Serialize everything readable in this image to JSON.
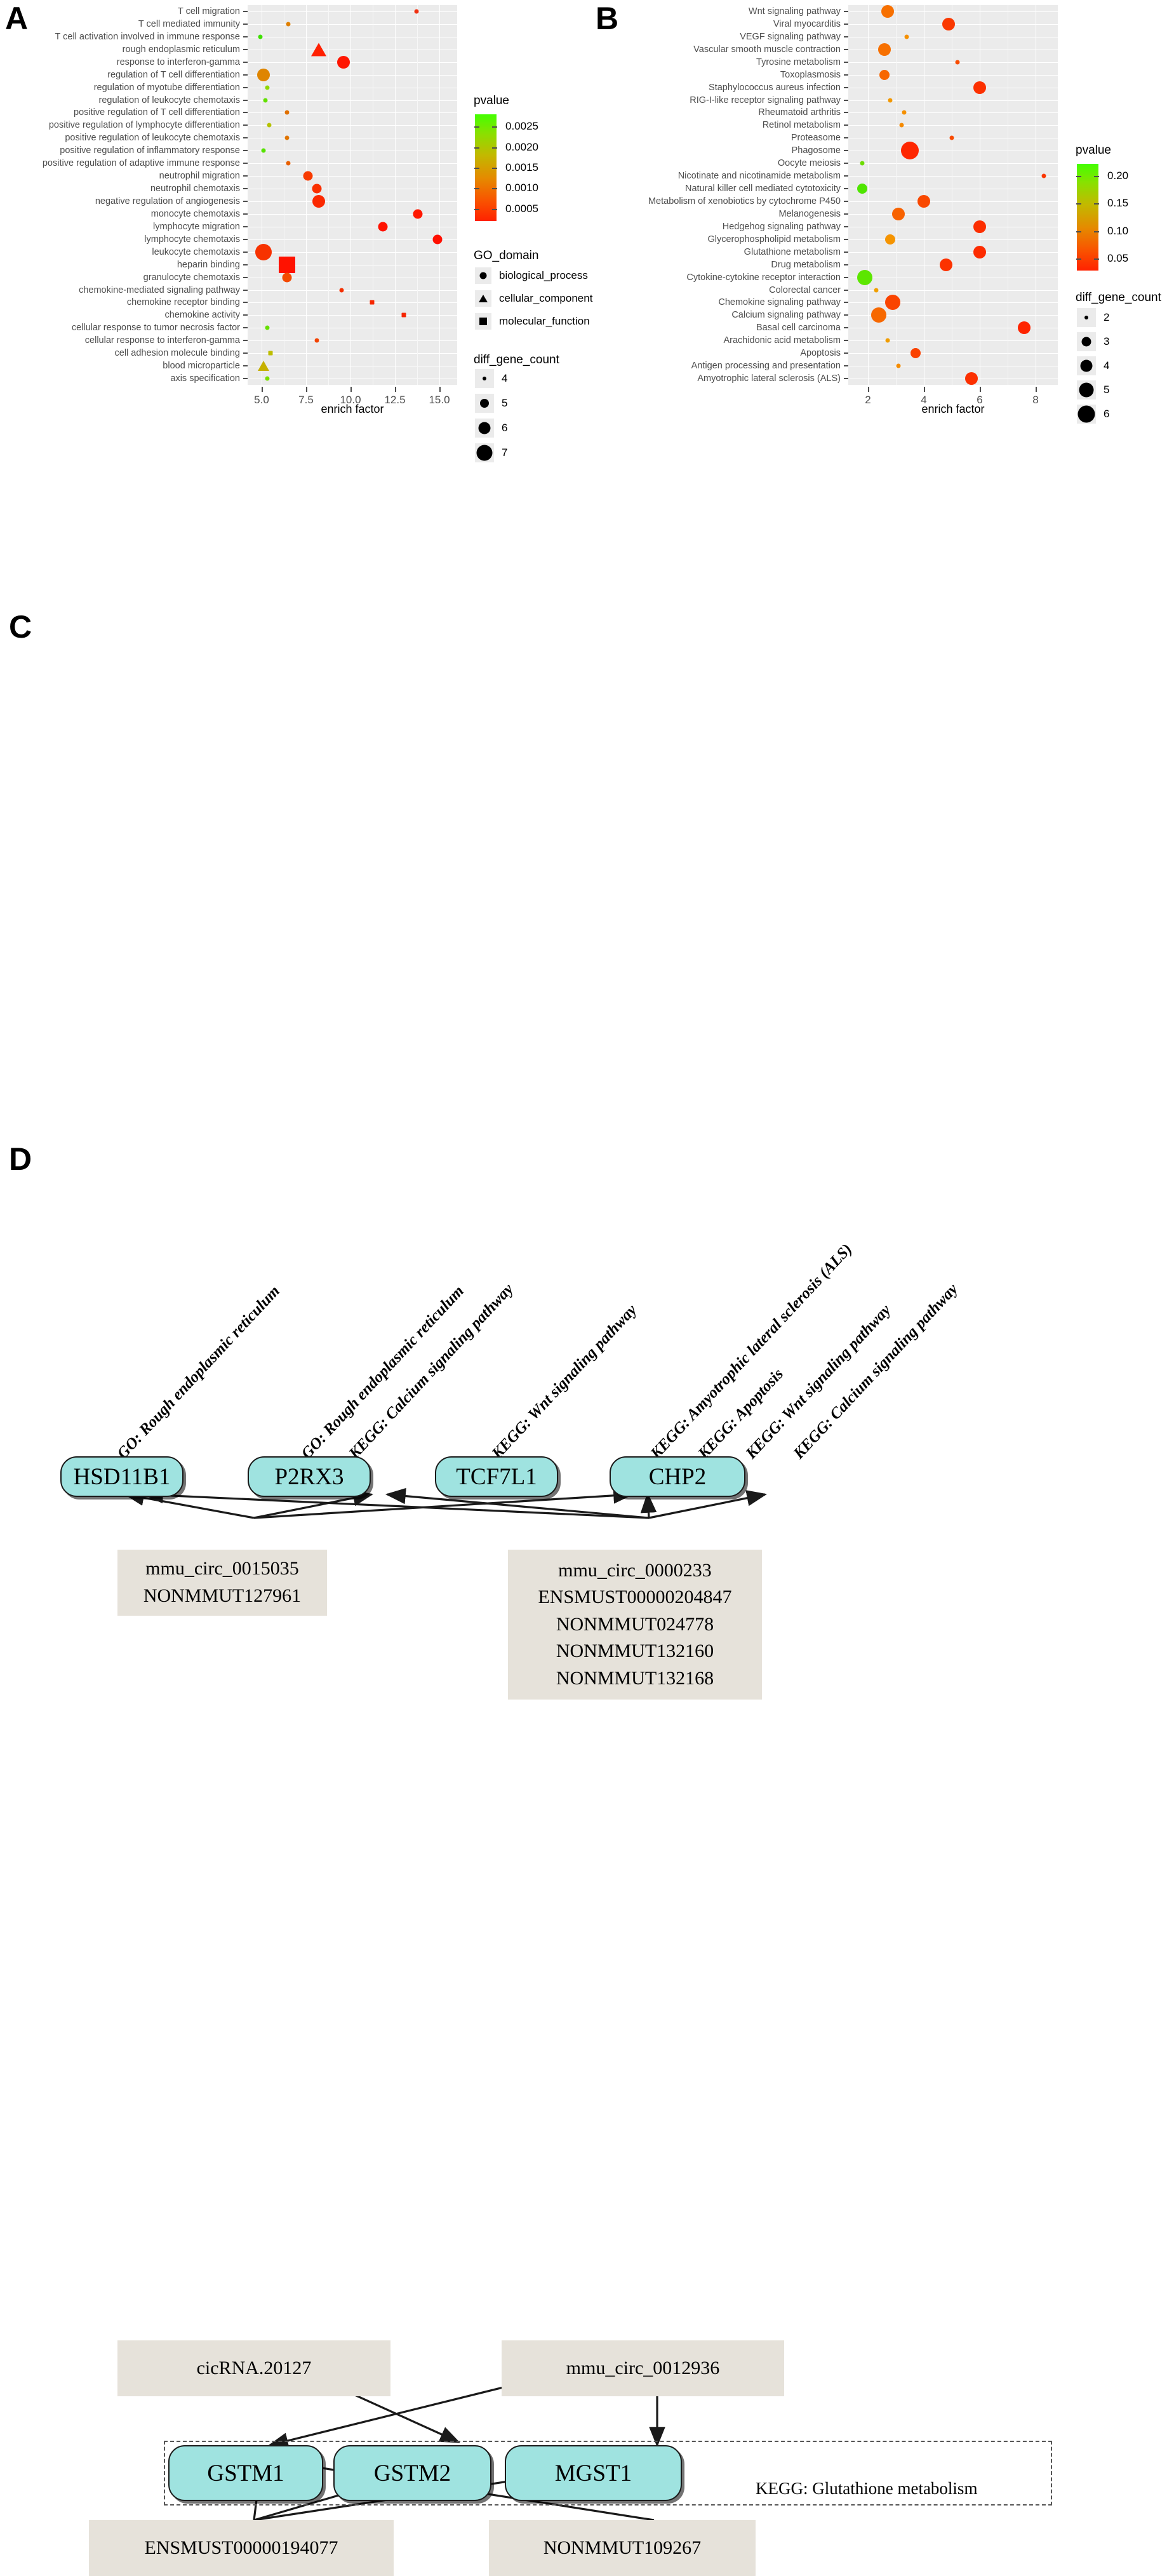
{
  "figure": {
    "panels": [
      "A",
      "B",
      "C",
      "D"
    ]
  },
  "panelA": {
    "letter": "A",
    "chart_data": {
      "type": "scatter",
      "title": "",
      "xlabel": "enrich factor",
      "ylabel": "",
      "xlim": [
        4.2,
        16.0
      ],
      "xticks": [
        "5.0",
        "7.5",
        "10.0",
        "12.5",
        "15.0"
      ],
      "xtickvalues": [
        5.0,
        7.5,
        10.0,
        12.5,
        15.0
      ],
      "grid": true,
      "legend_position": "right",
      "categories": [
        "T cell migration",
        "T cell mediated immunity",
        "T cell activation involved in immune response",
        "rough endoplasmic reticulum",
        "response to interferon-gamma",
        "regulation of T cell differentiation",
        "regulation of myotube differentiation",
        "regulation of leukocyte chemotaxis",
        "positive regulation of T cell differentiation",
        "positive regulation of lymphocyte differentiation",
        "positive regulation of leukocyte chemotaxis",
        "positive regulation of inflammatory response",
        "positive regulation of adaptive immune response",
        "neutrophil migration",
        "neutrophil chemotaxis",
        "negative regulation of angiogenesis",
        "monocyte chemotaxis",
        "lymphocyte migration",
        "lymphocyte chemotaxis",
        "leukocyte chemotaxis",
        "heparin binding",
        "granulocyte chemotaxis",
        "chemokine-mediated signaling pathway",
        "chemokine receptor binding",
        "chemokine activity",
        "cellular response to tumor necrosis factor",
        "cellular response to interferon-gamma",
        "cell adhesion molecule binding",
        "blood microparticle",
        "axis specification"
      ],
      "points": [
        {
          "category": "T cell migration",
          "enrich_factor": 13.7,
          "pvalue": 0.0004,
          "diff_gene_count": 4,
          "go_domain": "biological_process",
          "color": "#f03010"
        },
        {
          "category": "T cell mediated immunity",
          "enrich_factor": 6.5,
          "pvalue": 0.0013,
          "diff_gene_count": 4,
          "go_domain": "biological_process",
          "color": "#e08000"
        },
        {
          "category": "T cell activation involved in immune response",
          "enrich_factor": 4.9,
          "pvalue": 0.0026,
          "diff_gene_count": 4,
          "go_domain": "biological_process",
          "color": "#3fe000"
        },
        {
          "category": "rough endoplasmic reticulum",
          "enrich_factor": 8.2,
          "pvalue": 0.0002,
          "diff_gene_count": 6,
          "go_domain": "cellular_component",
          "color": "#ff2000"
        },
        {
          "category": "response to interferon-gamma",
          "enrich_factor": 9.6,
          "pvalue": 0.0002,
          "diff_gene_count": 6,
          "go_domain": "biological_process",
          "color": "#ff1500"
        },
        {
          "category": "regulation of T cell differentiation",
          "enrich_factor": 5.1,
          "pvalue": 0.0011,
          "diff_gene_count": 6,
          "go_domain": "biological_process",
          "color": "#df8500"
        },
        {
          "category": "regulation of myotube differentiation",
          "enrich_factor": 5.3,
          "pvalue": 0.0023,
          "diff_gene_count": 4,
          "go_domain": "biological_process",
          "color": "#90d800"
        },
        {
          "category": "regulation of leukocyte chemotaxis",
          "enrich_factor": 5.2,
          "pvalue": 0.0025,
          "diff_gene_count": 4,
          "go_domain": "biological_process",
          "color": "#62e000"
        },
        {
          "category": "positive regulation of T cell differentiation",
          "enrich_factor": 6.4,
          "pvalue": 0.0009,
          "diff_gene_count": 4,
          "go_domain": "biological_process",
          "color": "#e07000"
        },
        {
          "category": "positive regulation of lymphocyte differentiation",
          "enrich_factor": 5.4,
          "pvalue": 0.0019,
          "diff_gene_count": 4,
          "go_domain": "biological_process",
          "color": "#b5c200"
        },
        {
          "category": "positive regulation of leukocyte chemotaxis",
          "enrich_factor": 6.4,
          "pvalue": 0.0009,
          "diff_gene_count": 4,
          "go_domain": "biological_process",
          "color": "#e07500"
        },
        {
          "category": "positive regulation of inflammatory response",
          "enrich_factor": 5.1,
          "pvalue": 0.0026,
          "diff_gene_count": 4,
          "go_domain": "biological_process",
          "color": "#55e200"
        },
        {
          "category": "positive regulation of adaptive immune response",
          "enrich_factor": 6.5,
          "pvalue": 0.0007,
          "diff_gene_count": 4,
          "go_domain": "biological_process",
          "color": "#e86000"
        },
        {
          "category": "neutrophil migration",
          "enrich_factor": 7.6,
          "pvalue": 0.0003,
          "diff_gene_count": 5,
          "go_domain": "biological_process",
          "color": "#f83a00"
        },
        {
          "category": "neutrophil chemotaxis",
          "enrich_factor": 8.1,
          "pvalue": 0.0003,
          "diff_gene_count": 5,
          "go_domain": "biological_process",
          "color": "#fa3000"
        },
        {
          "category": "negative regulation of angiogenesis",
          "enrich_factor": 8.2,
          "pvalue": 0.0002,
          "diff_gene_count": 6,
          "go_domain": "biological_process",
          "color": "#fb2800"
        },
        {
          "category": "monocyte chemotaxis",
          "enrich_factor": 13.8,
          "pvalue": 0.0002,
          "diff_gene_count": 5,
          "go_domain": "biological_process",
          "color": "#ff1800"
        },
        {
          "category": "lymphocyte migration",
          "enrich_factor": 11.8,
          "pvalue": 0.0002,
          "diff_gene_count": 5,
          "go_domain": "biological_process",
          "color": "#ff1200"
        },
        {
          "category": "lymphocyte chemotaxis",
          "enrich_factor": 14.9,
          "pvalue": 0.0002,
          "diff_gene_count": 5,
          "go_domain": "biological_process",
          "color": "#ff1000"
        },
        {
          "category": "leukocyte chemotaxis",
          "enrich_factor": 5.1,
          "pvalue": 0.0003,
          "diff_gene_count": 7,
          "go_domain": "biological_process",
          "color": "#f73200"
        },
        {
          "category": "heparin binding",
          "enrich_factor": 6.4,
          "pvalue": 0.0002,
          "diff_gene_count": 7,
          "go_domain": "molecular_function",
          "color": "#ff1200"
        },
        {
          "category": "granulocyte chemotaxis",
          "enrich_factor": 6.4,
          "pvalue": 0.0005,
          "diff_gene_count": 5,
          "go_domain": "biological_process",
          "color": "#f44a00"
        },
        {
          "category": "chemokine-mediated signaling pathway",
          "enrich_factor": 9.5,
          "pvalue": 0.0004,
          "diff_gene_count": 4,
          "go_domain": "biological_process",
          "color": "#f43000"
        },
        {
          "category": "chemokine receptor binding",
          "enrich_factor": 11.2,
          "pvalue": 0.0003,
          "diff_gene_count": 4,
          "go_domain": "molecular_function",
          "color": "#f62800"
        },
        {
          "category": "chemokine activity",
          "enrich_factor": 13.0,
          "pvalue": 0.0003,
          "diff_gene_count": 4,
          "go_domain": "molecular_function",
          "color": "#f62600"
        },
        {
          "category": "cellular response to tumor necrosis factor",
          "enrich_factor": 5.3,
          "pvalue": 0.0025,
          "diff_gene_count": 4,
          "go_domain": "biological_process",
          "color": "#66e000"
        },
        {
          "category": "cellular response to interferon-gamma",
          "enrich_factor": 8.1,
          "pvalue": 0.0005,
          "diff_gene_count": 4,
          "go_domain": "biological_process",
          "color": "#f34300"
        },
        {
          "category": "cell adhesion molecule binding",
          "enrich_factor": 5.5,
          "pvalue": 0.0018,
          "diff_gene_count": 4,
          "go_domain": "molecular_function",
          "color": "#bdbd00"
        },
        {
          "category": "blood microparticle",
          "enrich_factor": 5.1,
          "pvalue": 0.0017,
          "diff_gene_count": 5,
          "go_domain": "cellular_component",
          "color": "#c6b000"
        },
        {
          "category": "axis specification",
          "enrich_factor": 5.3,
          "pvalue": 0.0024,
          "diff_gene_count": 4,
          "go_domain": "biological_process",
          "color": "#7ade00"
        }
      ]
    },
    "legends": {
      "pvalue": {
        "title": "pvalue",
        "ticks": [
          "0.0025",
          "0.0020",
          "0.0015",
          "0.0010",
          "0.0005"
        ],
        "tickvalues": [
          0.0025,
          0.002,
          0.0015,
          0.001,
          0.0005
        ],
        "gradient_high_color": "#44ff00",
        "gradient_low_color": "#ff2200"
      },
      "go_domain": {
        "title": "GO_domain",
        "items": [
          {
            "label": "biological_process",
            "shape": "circle"
          },
          {
            "label": "cellular_component",
            "shape": "triangle"
          },
          {
            "label": "molecular_function",
            "shape": "square"
          }
        ]
      },
      "diff_gene_count": {
        "title": "diff_gene_count",
        "items": [
          {
            "label": "4",
            "size": 6
          },
          {
            "label": "5",
            "size": 14
          },
          {
            "label": "6",
            "size": 19
          },
          {
            "label": "7",
            "size": 25
          }
        ]
      }
    }
  },
  "panelB": {
    "letter": "B",
    "chart_data": {
      "type": "scatter",
      "title": "",
      "xlabel": "enrich factor",
      "ylabel": "",
      "xlim": [
        1.3,
        8.8
      ],
      "xticks": [
        "2",
        "4",
        "6",
        "8"
      ],
      "xtickvalues": [
        2,
        4,
        6,
        8
      ],
      "grid": true,
      "legend_position": "right",
      "categories": [
        "Wnt signaling pathway",
        "Viral myocarditis",
        "VEGF signaling pathway",
        "Vascular smooth muscle contraction",
        "Tyrosine metabolism",
        "Toxoplasmosis",
        "Staphylococcus aureus infection",
        "RIG-I-like receptor signaling pathway",
        "Rheumatoid arthritis",
        "Retinol metabolism",
        "Proteasome",
        "Phagosome",
        "Oocyte meiosis",
        "Nicotinate and nicotinamide metabolism",
        "Natural killer cell mediated cytotoxicity",
        "Metabolism of xenobiotics by cytochrome P450",
        "Melanogenesis",
        "Hedgehog signaling pathway",
        "Glycerophospholipid metabolism",
        "Glutathione metabolism",
        "Drug metabolism",
        "Cytokine-cytokine receptor interaction",
        "Colorectal cancer",
        "Chemokine signaling pathway",
        "Calcium signaling pathway",
        "Basal cell carcinoma",
        "Arachidonic acid metabolism",
        "Apoptosis",
        "Antigen processing and presentation",
        "Amyotrophic lateral sclerosis (ALS)"
      ],
      "points": [
        {
          "category": "Wnt signaling pathway",
          "enrich_factor": 2.7,
          "pvalue": 0.055,
          "diff_gene_count": 4,
          "color": "#f77000"
        },
        {
          "category": "Viral myocarditis",
          "enrich_factor": 4.9,
          "pvalue": 0.035,
          "diff_gene_count": 4,
          "color": "#fa3800"
        },
        {
          "category": "VEGF signaling pathway",
          "enrich_factor": 3.4,
          "pvalue": 0.075,
          "diff_gene_count": 2,
          "color": "#f59000"
        },
        {
          "category": "Vascular smooth muscle contraction",
          "enrich_factor": 2.6,
          "pvalue": 0.055,
          "diff_gene_count": 4,
          "color": "#f77000"
        },
        {
          "category": "Tyrosine metabolism",
          "enrich_factor": 5.2,
          "pvalue": 0.045,
          "diff_gene_count": 2,
          "color": "#f84c00"
        },
        {
          "category": "Toxoplasmosis",
          "enrich_factor": 2.6,
          "pvalue": 0.05,
          "diff_gene_count": 3,
          "color": "#f76600"
        },
        {
          "category": "Staphylococcus aureus infection",
          "enrich_factor": 6.0,
          "pvalue": 0.03,
          "diff_gene_count": 4,
          "color": "#fc3000"
        },
        {
          "category": "RIG-I-like receptor signaling pathway",
          "enrich_factor": 2.8,
          "pvalue": 0.085,
          "diff_gene_count": 2,
          "color": "#f29800"
        },
        {
          "category": "Rheumatoid arthritis",
          "enrich_factor": 3.3,
          "pvalue": 0.075,
          "diff_gene_count": 2,
          "color": "#f59000"
        },
        {
          "category": "Retinol metabolism",
          "enrich_factor": 3.2,
          "pvalue": 0.07,
          "diff_gene_count": 2,
          "color": "#f58a00"
        },
        {
          "category": "Proteasome",
          "enrich_factor": 5.0,
          "pvalue": 0.045,
          "diff_gene_count": 2,
          "color": "#f84c00"
        },
        {
          "category": "Phagosome",
          "enrich_factor": 3.5,
          "pvalue": 0.02,
          "diff_gene_count": 6,
          "color": "#fe2600"
        },
        {
          "category": "Oocyte meiosis",
          "enrich_factor": 1.8,
          "pvalue": 0.19,
          "diff_gene_count": 2,
          "color": "#6ddc00"
        },
        {
          "category": "Nicotinate and nicotinamide metabolism",
          "enrich_factor": 8.3,
          "pvalue": 0.035,
          "diff_gene_count": 2,
          "color": "#fa3800"
        },
        {
          "category": "Natural killer cell mediated cytotoxicity",
          "enrich_factor": 1.8,
          "pvalue": 0.2,
          "diff_gene_count": 3,
          "color": "#4fe500"
        },
        {
          "category": "Metabolism of xenobiotics by cytochrome P450",
          "enrich_factor": 4.0,
          "pvalue": 0.045,
          "diff_gene_count": 4,
          "color": "#f94800"
        },
        {
          "category": "Melanogenesis",
          "enrich_factor": 3.1,
          "pvalue": 0.048,
          "diff_gene_count": 4,
          "color": "#f86200"
        },
        {
          "category": "Hedgehog signaling pathway",
          "enrich_factor": 6.0,
          "pvalue": 0.028,
          "diff_gene_count": 4,
          "color": "#fc2e00"
        },
        {
          "category": "Glycerophospholipid metabolism",
          "enrich_factor": 2.8,
          "pvalue": 0.08,
          "diff_gene_count": 3,
          "color": "#f59400"
        },
        {
          "category": "Glutathione metabolism",
          "enrich_factor": 6.0,
          "pvalue": 0.026,
          "diff_gene_count": 4,
          "color": "#fd2c00"
        },
        {
          "category": "Drug metabolism",
          "enrich_factor": 4.8,
          "pvalue": 0.03,
          "diff_gene_count": 4,
          "color": "#fc3200"
        },
        {
          "category": "Cytokine-cytokine receptor interaction",
          "enrich_factor": 1.9,
          "pvalue": 0.23,
          "diff_gene_count": 5,
          "color": "#5ce600"
        },
        {
          "category": "Colorectal cancer",
          "enrich_factor": 2.3,
          "pvalue": 0.095,
          "diff_gene_count": 2,
          "color": "#f0a000"
        },
        {
          "category": "Chemokine signaling pathway",
          "enrich_factor": 2.9,
          "pvalue": 0.04,
          "diff_gene_count": 5,
          "color": "#fa4400"
        },
        {
          "category": "Calcium signaling pathway",
          "enrich_factor": 2.4,
          "pvalue": 0.048,
          "diff_gene_count": 5,
          "color": "#f76800"
        },
        {
          "category": "Basal cell carcinoma",
          "enrich_factor": 7.6,
          "pvalue": 0.022,
          "diff_gene_count": 4,
          "color": "#fe2400"
        },
        {
          "category": "Arachidonic acid metabolism",
          "enrich_factor": 2.7,
          "pvalue": 0.09,
          "diff_gene_count": 2,
          "color": "#f09c00"
        },
        {
          "category": "Apoptosis",
          "enrich_factor": 3.7,
          "pvalue": 0.04,
          "diff_gene_count": 3,
          "color": "#fa4200"
        },
        {
          "category": "Antigen processing and presentation",
          "enrich_factor": 3.1,
          "pvalue": 0.075,
          "diff_gene_count": 2,
          "color": "#f58c00"
        },
        {
          "category": "Amyotrophic lateral sclerosis (ALS)",
          "enrich_factor": 5.7,
          "pvalue": 0.03,
          "diff_gene_count": 4,
          "color": "#fc3000"
        }
      ]
    },
    "legends": {
      "pvalue": {
        "title": "pvalue",
        "ticks": [
          "0.20",
          "0.15",
          "0.10",
          "0.05"
        ],
        "tickvalues": [
          0.2,
          0.15,
          0.1,
          0.05
        ],
        "gradient_high_color": "#44ff00",
        "gradient_low_color": "#ff2200"
      },
      "diff_gene_count": {
        "title": "diff_gene_count",
        "items": [
          {
            "label": "2",
            "size": 6
          },
          {
            "label": "3",
            "size": 15
          },
          {
            "label": "4",
            "size": 19
          },
          {
            "label": "5",
            "size": 23
          },
          {
            "label": "6",
            "size": 27
          }
        ]
      }
    }
  },
  "panelC": {
    "letter": "C",
    "genes": [
      {
        "name": "HSD11B1"
      },
      {
        "name": "P2RX3"
      },
      {
        "name": "TCF7L1"
      },
      {
        "name": "CHP2"
      }
    ],
    "pathway_labels": [
      "GO: Rough endoplasmic reticulum",
      "GO: Rough endoplasmic reticulum",
      "KEGG: Calcium signaling pathway",
      "KEGG: Wnt signaling pathway",
      "KEGG: Amyotrophic lateral sclerosis (ALS)",
      "KEGG: Apoptosis",
      "KEGG: Wnt signaling pathway",
      "KEGG: Calcium signaling pathway"
    ],
    "rna_groups": [
      {
        "lines": [
          "mmu_circ_0015035",
          "NONMMUT127961"
        ]
      },
      {
        "lines": [
          "mmu_circ_0000233",
          "ENSMUST00000204847",
          "NONMMUT024778",
          "NONMMUT132160",
          "NONMMUT132168"
        ]
      }
    ]
  },
  "panelD": {
    "letter": "D",
    "top_rna": [
      {
        "label": "cicRNA.20127"
      },
      {
        "label": "mmu_circ_0012936"
      }
    ],
    "genes": [
      {
        "name": "GSTM1"
      },
      {
        "name": "GSTM2"
      },
      {
        "name": "MGST1"
      }
    ],
    "group_caption": "KEGG: Glutathione metabolism",
    "bottom_rna": [
      {
        "label": "ENSMUST00000194077"
      },
      {
        "label": "NONMMUT109267"
      }
    ]
  }
}
